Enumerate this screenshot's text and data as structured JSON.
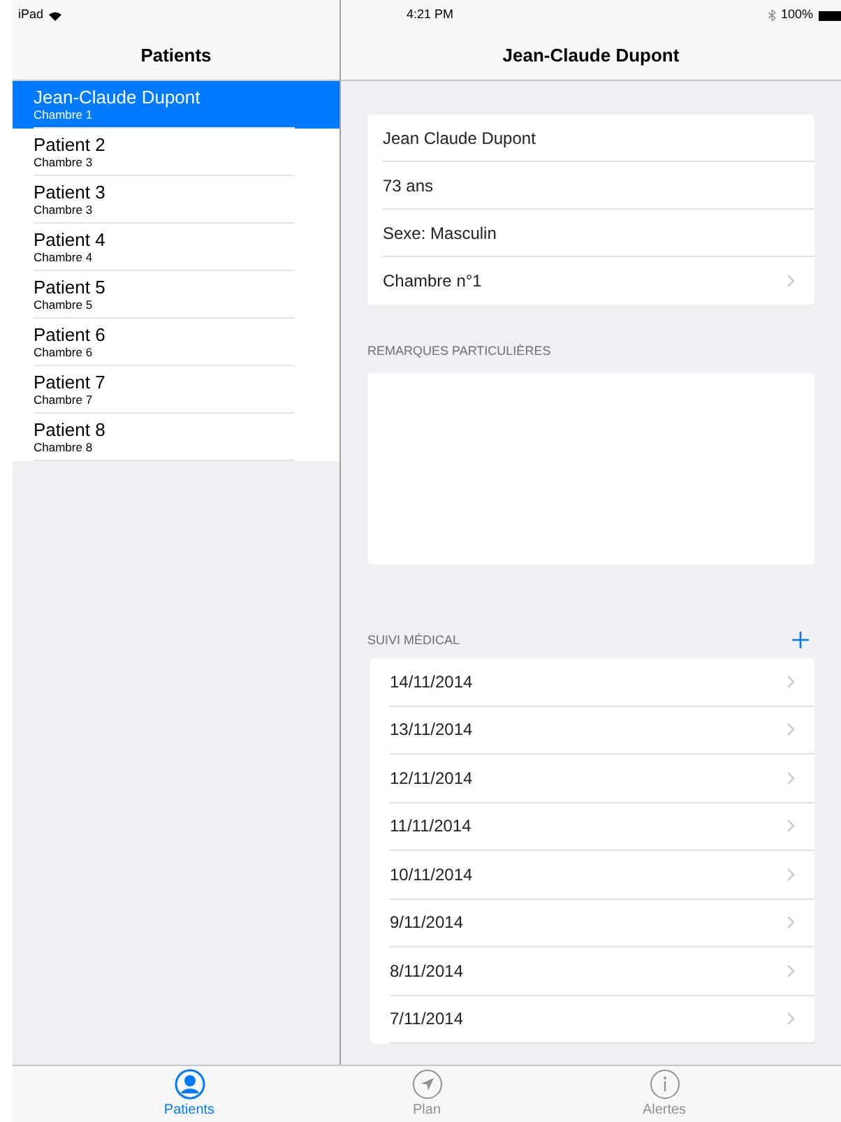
{
  "status_bar": {
    "device": "iPad",
    "time": "4:21 PM",
    "battery": "100%"
  },
  "sidebar": {
    "title": "Patients",
    "items": [
      {
        "name": "Jean-Claude Dupont",
        "room": "Chambre 1",
        "selected": true
      },
      {
        "name": "Patient 2",
        "room": "Chambre 3",
        "selected": false
      },
      {
        "name": "Patient 3",
        "room": "Chambre 3",
        "selected": false
      },
      {
        "name": "Patient 4",
        "room": "Chambre 4",
        "selected": false
      },
      {
        "name": "Patient 5",
        "room": "Chambre 5",
        "selected": false
      },
      {
        "name": "Patient 6",
        "room": "Chambre 6",
        "selected": false
      },
      {
        "name": "Patient 7",
        "room": "Chambre 7",
        "selected": false
      },
      {
        "name": "Patient 8",
        "room": "Chambre 8",
        "selected": false
      }
    ]
  },
  "detail": {
    "title": "Jean-Claude Dupont",
    "info": [
      {
        "text": "Jean Claude Dupont",
        "disclosure": false
      },
      {
        "text": "73 ans",
        "disclosure": false
      },
      {
        "text": "Sexe: Masculin",
        "disclosure": false
      },
      {
        "text": "Chambre n°1",
        "disclosure": true
      }
    ],
    "remarks_header": "REMARQUES PARTICULIÈRES",
    "followup_header": "SUIVI MÉDICAL",
    "followup": [
      "14/11/2014",
      "13/11/2014",
      "12/11/2014",
      "11/11/2014",
      "10/11/2014",
      "9/11/2014",
      "8/11/2014",
      "7/11/2014"
    ]
  },
  "tabs": [
    {
      "label": "Patients",
      "kind": "person",
      "selected": true
    },
    {
      "label": "Plan",
      "kind": "location",
      "selected": false
    },
    {
      "label": "Alertes",
      "kind": "info",
      "selected": false
    }
  ]
}
